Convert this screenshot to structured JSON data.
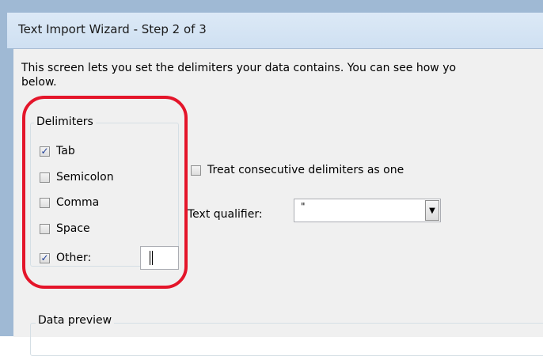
{
  "window": {
    "title": "Text Import Wizard - Step 2 of 3"
  },
  "description": {
    "line1": "This screen lets you set the delimiters your data contains.  You can see how yo",
    "line2": "below."
  },
  "delimiters": {
    "group_label": "Delimiters",
    "items": [
      {
        "label": "Tab",
        "checked": true
      },
      {
        "label": "Semicolon",
        "checked": false
      },
      {
        "label": "Comma",
        "checked": false
      },
      {
        "label": "Space",
        "checked": false
      },
      {
        "label": "Other:",
        "checked": true
      }
    ],
    "other_value": ""
  },
  "treat_consecutive": {
    "label": "Treat consecutive delimiters as one",
    "checked": false
  },
  "text_qualifier": {
    "label": "Text qualifier:",
    "value": "\""
  },
  "data_preview": {
    "label": "Data preview"
  },
  "annotation": {
    "color": "#e4152a"
  }
}
